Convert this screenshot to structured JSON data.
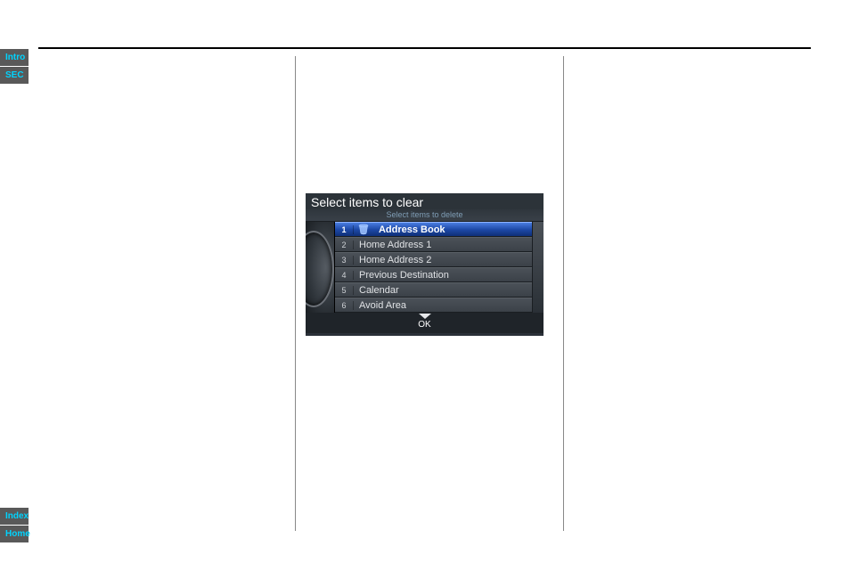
{
  "side_tabs": {
    "intro": "Intro",
    "sec": "SEC"
  },
  "bottom_tabs": {
    "index": "Index",
    "home": "Home"
  },
  "nav": {
    "title": "Select items to clear",
    "subtitle": "Select items to delete",
    "ok": "OK",
    "items": [
      {
        "num": "1",
        "label": "Address Book",
        "selected": true,
        "icon": "trash"
      },
      {
        "num": "2",
        "label": "Home Address 1",
        "selected": false
      },
      {
        "num": "3",
        "label": "Home Address 2",
        "selected": false
      },
      {
        "num": "4",
        "label": "Previous Destination",
        "selected": false
      },
      {
        "num": "5",
        "label": "Calendar",
        "selected": false
      },
      {
        "num": "6",
        "label": "Avoid Area",
        "selected": false
      }
    ]
  }
}
